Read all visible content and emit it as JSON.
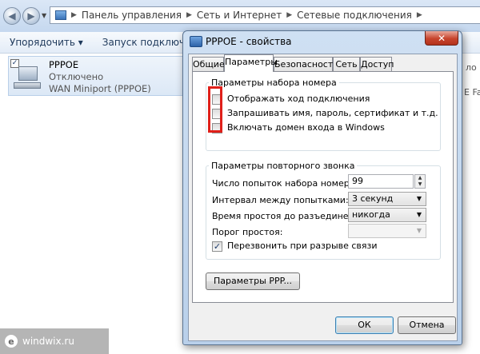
{
  "explorer": {
    "breadcrumb": [
      "Панель управления",
      "Сеть и Интернет",
      "Сетевые подключения"
    ],
    "toolbar": {
      "organize": "Упорядочить ▾",
      "start_connection": "Запуск подключения"
    },
    "connection": {
      "name": "PPPOE",
      "status": "Отключено",
      "device": "WAN Miniport (PPPOE)"
    },
    "right_partial": [
      "ло",
      "E Far"
    ]
  },
  "dialog": {
    "title": "PPPOE - свойства",
    "close_label": "✕",
    "tabs": [
      {
        "label": "Общие"
      },
      {
        "label": "Параметры"
      },
      {
        "label": "Безопасность"
      },
      {
        "label": "Сеть"
      },
      {
        "label": "Доступ"
      }
    ],
    "dial_options": {
      "group_label": "Параметры набора номера",
      "items": [
        {
          "label": "Отображать ход подключения",
          "checked": false
        },
        {
          "label": "Запрашивать имя, пароль, сертификат и т.д.",
          "checked": false
        },
        {
          "label": "Включать домен входа в Windows",
          "checked": false
        }
      ]
    },
    "redial_options": {
      "group_label": "Параметры повторного звонка",
      "redial_attempts_label": "Число попыток набора номера:",
      "redial_attempts_value": "99",
      "interval_label": "Интервал между попытками:",
      "interval_value": "3 секунд",
      "idle_label": "Время простоя до разъединения:",
      "idle_value": "никогда",
      "idle_threshold_label": "Порог простоя:",
      "idle_threshold_value": "",
      "redial_on_drop_label": "Перезвонить при разрыве связи",
      "redial_on_drop_checked": true
    },
    "ppp_button": "Параметры PPP...",
    "ok_button": "ОК",
    "cancel_button": "Отмена"
  },
  "watermark": {
    "logo_letter": "e",
    "text": "windwix.ru"
  }
}
